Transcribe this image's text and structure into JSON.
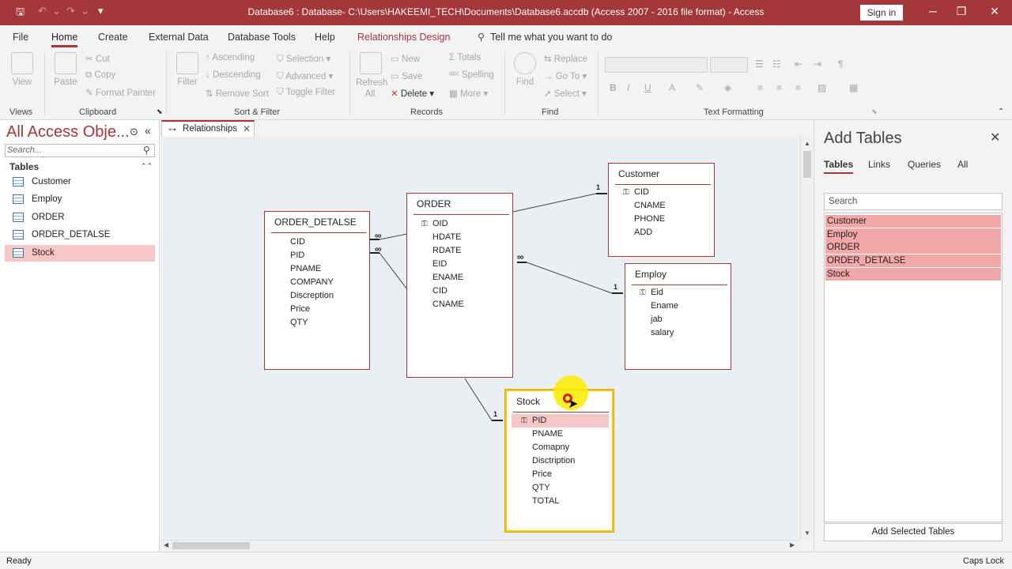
{
  "titlebar": {
    "title": "Database6 : Database- C:\\Users\\HAKEEMI_TECH\\Documents\\Database6.accdb (Access 2007 - 2016 file format)  -  Access",
    "sign_in": "Sign in"
  },
  "ribbon_tabs": [
    "File",
    "Home",
    "Create",
    "External Data",
    "Database Tools",
    "Help",
    "Relationships Design"
  ],
  "tell_me": "Tell me what you want to do",
  "ribbon": {
    "views": {
      "view": "View",
      "group": "Views"
    },
    "clipboard": {
      "paste": "Paste",
      "cut": "Cut",
      "copy": "Copy",
      "format_painter": "Format Painter",
      "group": "Clipboard"
    },
    "sort_filter": {
      "filter": "Filter",
      "ascending": "Ascending",
      "descending": "Descending",
      "remove_sort": "Remove Sort",
      "selection": "Selection",
      "advanced": "Advanced",
      "toggle_filter": "Toggle Filter",
      "group": "Sort & Filter"
    },
    "records": {
      "refresh_all": "Refresh All",
      "new": "New",
      "save": "Save",
      "delete": "Delete",
      "totals": "Totals",
      "spelling": "Spelling",
      "more": "More",
      "group": "Records"
    },
    "find": {
      "find": "Find",
      "replace": "Replace",
      "goto": "Go To",
      "select": "Select",
      "group": "Find"
    },
    "text_formatting": {
      "group": "Text Formatting"
    }
  },
  "nav": {
    "title": "All Access Obje...",
    "search_placeholder": "Search...",
    "section": "Tables",
    "items": [
      "Customer",
      "Employ",
      "ORDER",
      "ORDER_DETALSE",
      "Stock"
    ],
    "selected": "Stock"
  },
  "doc_tab": "Relationships",
  "tables": {
    "order_detalse": {
      "name": "ORDER_DETALSE",
      "fields": [
        "CID",
        "PID",
        "PNAME",
        "COMPANY",
        "Discreption",
        "Price",
        "QTY"
      ]
    },
    "order": {
      "name": "ORDER",
      "fields": [
        "OID",
        "HDATE",
        "RDATE",
        "EID",
        "ENAME",
        "CID",
        "CNAME"
      ],
      "key": "OID"
    },
    "customer": {
      "name": "Customer",
      "fields": [
        "CID",
        "CNAME",
        "PHONE",
        "ADD"
      ],
      "key": "CID"
    },
    "employ": {
      "name": "Employ",
      "fields": [
        "Eid",
        "Ename",
        "jab",
        "salary"
      ],
      "key": "Eid"
    },
    "stock": {
      "name": "Stock",
      "fields": [
        "PID",
        "PNAME",
        "Comapny",
        "Disctription",
        "Price",
        "QTY",
        "TOTAL"
      ],
      "key": "PID"
    }
  },
  "relationship_labels": {
    "one": "1",
    "many": "∞"
  },
  "add_tables": {
    "title": "Add Tables",
    "tabs": [
      "Tables",
      "Links",
      "Queries",
      "All"
    ],
    "search_placeholder": "Search",
    "items": [
      "Customer",
      "Employ",
      "ORDER",
      "ORDER_DETALSE",
      "Stock"
    ],
    "button": "Add Selected Tables"
  },
  "status": {
    "left": "Ready",
    "right": "Caps Lock"
  },
  "colors": {
    "accent": "#a4373a",
    "selection": "#f7c6c7"
  }
}
